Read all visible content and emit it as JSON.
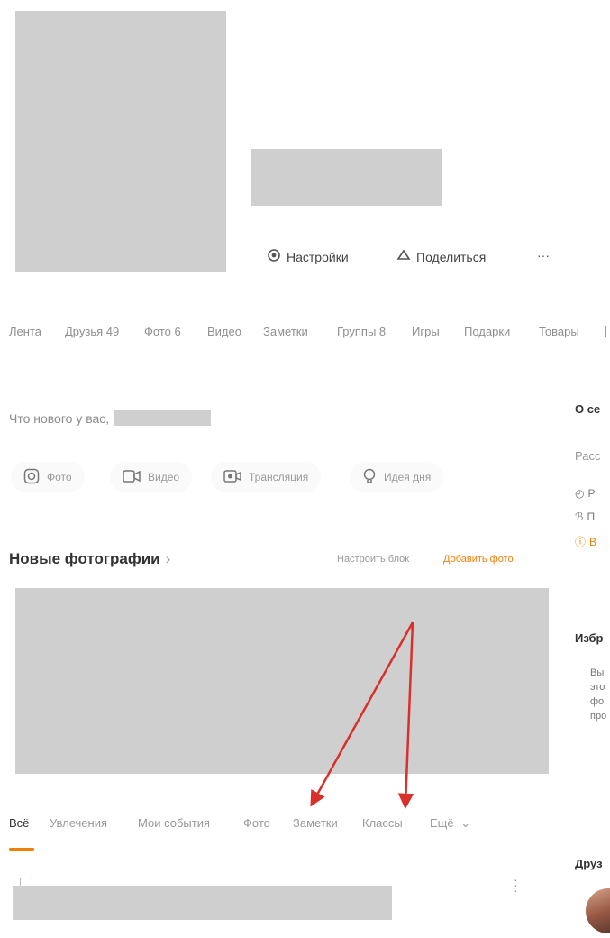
{
  "profile": {
    "settings_label": "Настройки",
    "share_label": "Поделиться",
    "more_label": "···"
  },
  "tabs": [
    {
      "label": "Лента"
    },
    {
      "label": "Друзья 49"
    },
    {
      "label": "Фото 6"
    },
    {
      "label": "Видео"
    },
    {
      "label": "Заметки"
    },
    {
      "label": "Группы 8"
    },
    {
      "label": "Игры"
    },
    {
      "label": "Подарки"
    },
    {
      "label": "Товары"
    }
  ],
  "composer": {
    "prompt": "Что нового у вас,",
    "actions": [
      {
        "label": "Фото",
        "icon": "camera-icon"
      },
      {
        "label": "Видео",
        "icon": "video-icon"
      },
      {
        "label": "Трансляция",
        "icon": "broadcast-icon"
      },
      {
        "label": "Идея дня",
        "icon": "lightbulb-icon"
      }
    ]
  },
  "photos_block": {
    "title": "Новые фотографии",
    "chevron": "›",
    "configure_label": "Настроить блок",
    "add_label": "Добавить фото"
  },
  "feed_filters": [
    {
      "label": "Всё",
      "active": true
    },
    {
      "label": "Увлечения"
    },
    {
      "label": "Мои события"
    },
    {
      "label": "Фото"
    },
    {
      "label": "Заметки"
    },
    {
      "label": "Классы"
    },
    {
      "label": "Ещё"
    }
  ],
  "sidebar": {
    "about_title": "О се",
    "about_text": "Расс",
    "row1": "Р",
    "row2": "П",
    "row3": "В",
    "featured_title": "Избр",
    "featured_lines": [
      "Вы",
      "это",
      "фо",
      "про"
    ],
    "friends_title": "Друз"
  },
  "colors": {
    "accent": "#ee8208",
    "arrow": "#d9302c"
  }
}
